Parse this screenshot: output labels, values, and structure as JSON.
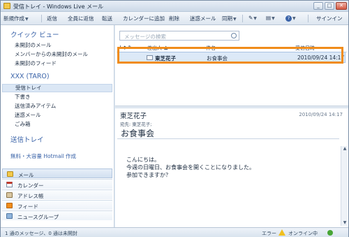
{
  "window": {
    "title": "受信トレイ - Windows Live メール"
  },
  "toolbar": {
    "new": "新規作成",
    "reply": "返信",
    "reply_all": "全員に返信",
    "forward": "転送",
    "add_calendar": "カレンダーに追加",
    "delete": "削除",
    "junk": "迷惑メール",
    "sync": "同期",
    "signin": "サインイン"
  },
  "sidebar": {
    "quick_views_title": "クイック ビュー",
    "quick_views": [
      "未開封のメール",
      "メンバーからの未開封のメール",
      "未開封のフィード"
    ],
    "account_title": "XXX (TARO)",
    "folders": [
      "受信トレイ",
      "下書き",
      "送信済みアイテム",
      "迷惑メール",
      "ごみ箱"
    ],
    "outbox": "送信トレイ",
    "hotmail_link": "無料・大容量 Hotmail 作成",
    "nav": [
      "メール",
      "カレンダー",
      "アドレス帳",
      "フィード",
      "ニュースグループ"
    ]
  },
  "list": {
    "search_placeholder": "メッセージの検索",
    "columns": {
      "icons": "! ◆ ✎",
      "from": "差出人",
      "subject": "件名",
      "date": "受信日時"
    },
    "messages": [
      {
        "from": "東芝花子",
        "subject": "お食事会",
        "date": "2010/09/24 14:17"
      }
    ]
  },
  "reading": {
    "from": "東芝花子",
    "date": "2010/09/24 14:17",
    "to": "宛先: 東芝花子;",
    "subject": "お食事会",
    "body": [
      "こんにちは。",
      "今週の日曜日、お食事会を開くことになりました。",
      "参加できますか？"
    ]
  },
  "status": {
    "left": "1 通のメッセージ、0 通は未開封",
    "right": "エラー",
    "online": "オンライン中"
  },
  "colors": {
    "highlight": "#f08c1a",
    "accent": "#3a63a8"
  }
}
